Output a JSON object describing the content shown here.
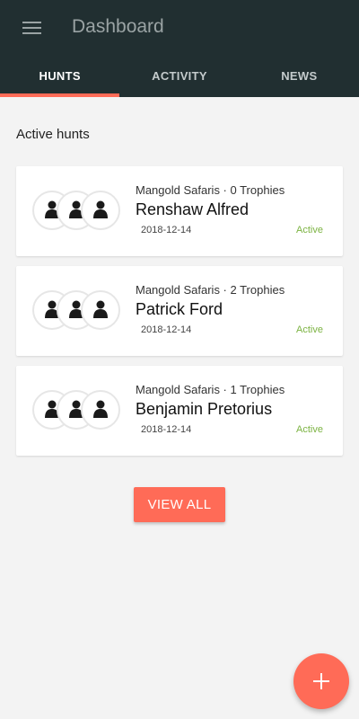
{
  "header": {
    "title": "Dashboard",
    "menu_icon": "hamburger-menu-icon",
    "background_color": "#212f31"
  },
  "tabs": [
    {
      "label": "HUNTS",
      "active": true
    },
    {
      "label": "ACTIVITY",
      "active": false
    },
    {
      "label": "NEWS",
      "active": false
    }
  ],
  "accent_color": "#ff6b57",
  "section": {
    "label": "Active hunts"
  },
  "hunts": [
    {
      "subtitle": "Mangold Safaris · 0 Trophies",
      "name": "Renshaw Alfred",
      "date": "2018-12-14",
      "status": "Active",
      "avatar_icons": [
        "person-icon",
        "person-icon",
        "person-icon"
      ]
    },
    {
      "subtitle": "Mangold Safaris · 2 Trophies",
      "name": "Patrick Ford",
      "date": "2018-12-14",
      "status": "Active",
      "avatar_icons": [
        "person-icon",
        "person-icon",
        "person-icon"
      ]
    },
    {
      "subtitle": "Mangold Safaris · 1 Trophies",
      "name": "Benjamin Pretorius",
      "date": "2018-12-14",
      "status": "Active",
      "avatar_icons": [
        "person-icon",
        "person-icon",
        "person-icon"
      ]
    }
  ],
  "status_color": "#7cb342",
  "view_all_label": "VIEW ALL",
  "fab": {
    "icon": "plus-icon"
  }
}
